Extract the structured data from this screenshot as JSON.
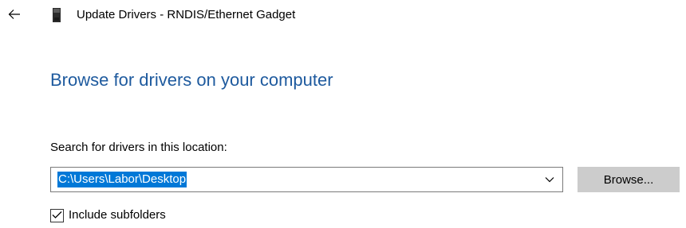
{
  "header": {
    "back_icon": "arrow-left-icon",
    "device_icon": "device-icon",
    "title": "Update Drivers - RNDIS/Ethernet Gadget"
  },
  "main": {
    "heading": "Browse for drivers on your computer",
    "location_label": "Search for drivers in this location:",
    "path_value": "C:\\Users\\Labor\\Desktop",
    "dropdown_icon": "chevron-down-icon",
    "browse_label": "Browse...",
    "include_subfolders": {
      "label": "Include subfolders",
      "checked": true
    }
  },
  "colors": {
    "heading": "#1e5a9e",
    "selection": "#0078d7",
    "button_bg": "#cccccc"
  }
}
